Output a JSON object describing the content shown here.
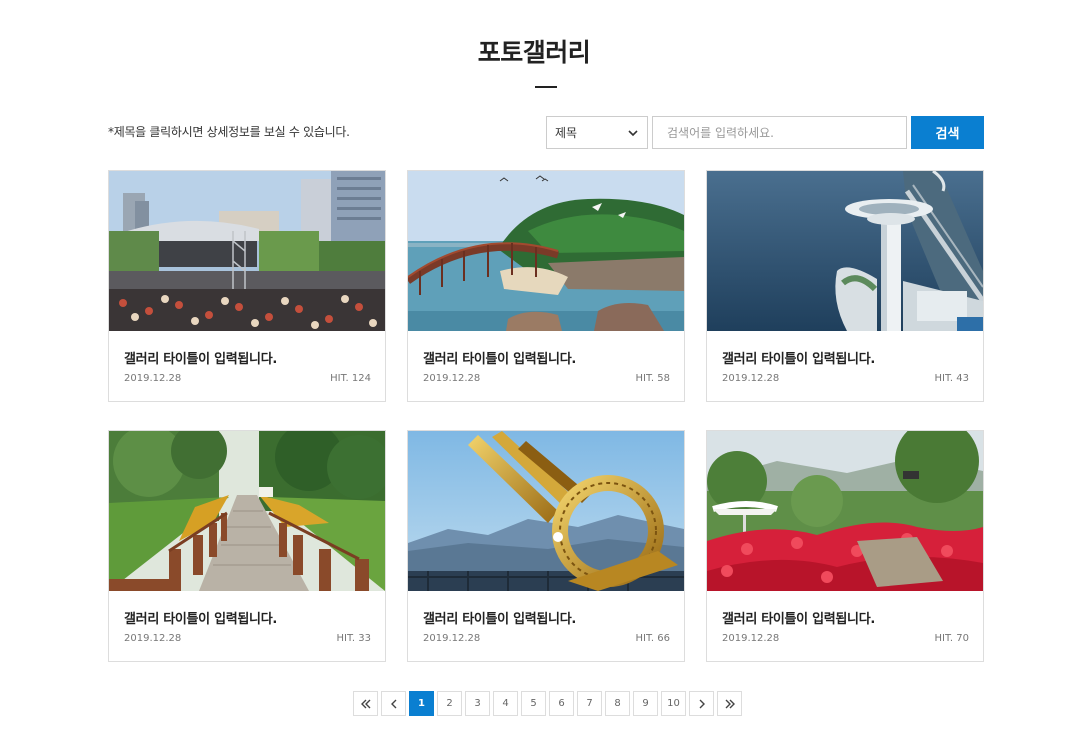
{
  "page": {
    "title": "포토갤러리",
    "notice": "*제목을 클릭하시면 상세정보를 보실 수 있습니다."
  },
  "search": {
    "select_value": "제목",
    "placeholder": "검색어를 입력하세요.",
    "button_label": "검색"
  },
  "gallery": [
    {
      "title": "갤러리 타이틀이 입력됩니다.",
      "date": "2019.12.28",
      "hits": "HIT. 124",
      "image": "festival-stage-photo"
    },
    {
      "title": "갤러리 타이틀이 입력됩니다.",
      "date": "2019.12.28",
      "hits": "HIT. 58",
      "image": "island-bridge-photo"
    },
    {
      "title": "갤러리 타이틀이 입력됩니다.",
      "date": "2019.12.28",
      "hits": "HIT. 43",
      "image": "observation-tower-photo"
    },
    {
      "title": "갤러리 타이틀이 입력됩니다.",
      "date": "2019.12.28",
      "hits": "HIT. 33",
      "image": "wooden-boardwalk-photo"
    },
    {
      "title": "갤러리 타이틀이 입력됩니다.",
      "date": "2019.12.28",
      "hits": "HIT. 66",
      "image": "ring-sculpture-photo"
    },
    {
      "title": "갤러리 타이틀이 입력됩니다.",
      "date": "2019.12.28",
      "hits": "HIT. 70",
      "image": "azalea-park-photo"
    }
  ],
  "pagination": {
    "first_icon": "double-chevron-left-icon",
    "prev_icon": "chevron-left-icon",
    "pages": [
      "1",
      "2",
      "3",
      "4",
      "5",
      "6",
      "7",
      "8",
      "9",
      "10"
    ],
    "current": "1",
    "next_icon": "chevron-right-icon",
    "last_icon": "double-chevron-right-icon"
  },
  "colors": {
    "accent": "#0a7fd1",
    "border": "#dddddd",
    "text": "#222222",
    "muted": "#777777"
  }
}
